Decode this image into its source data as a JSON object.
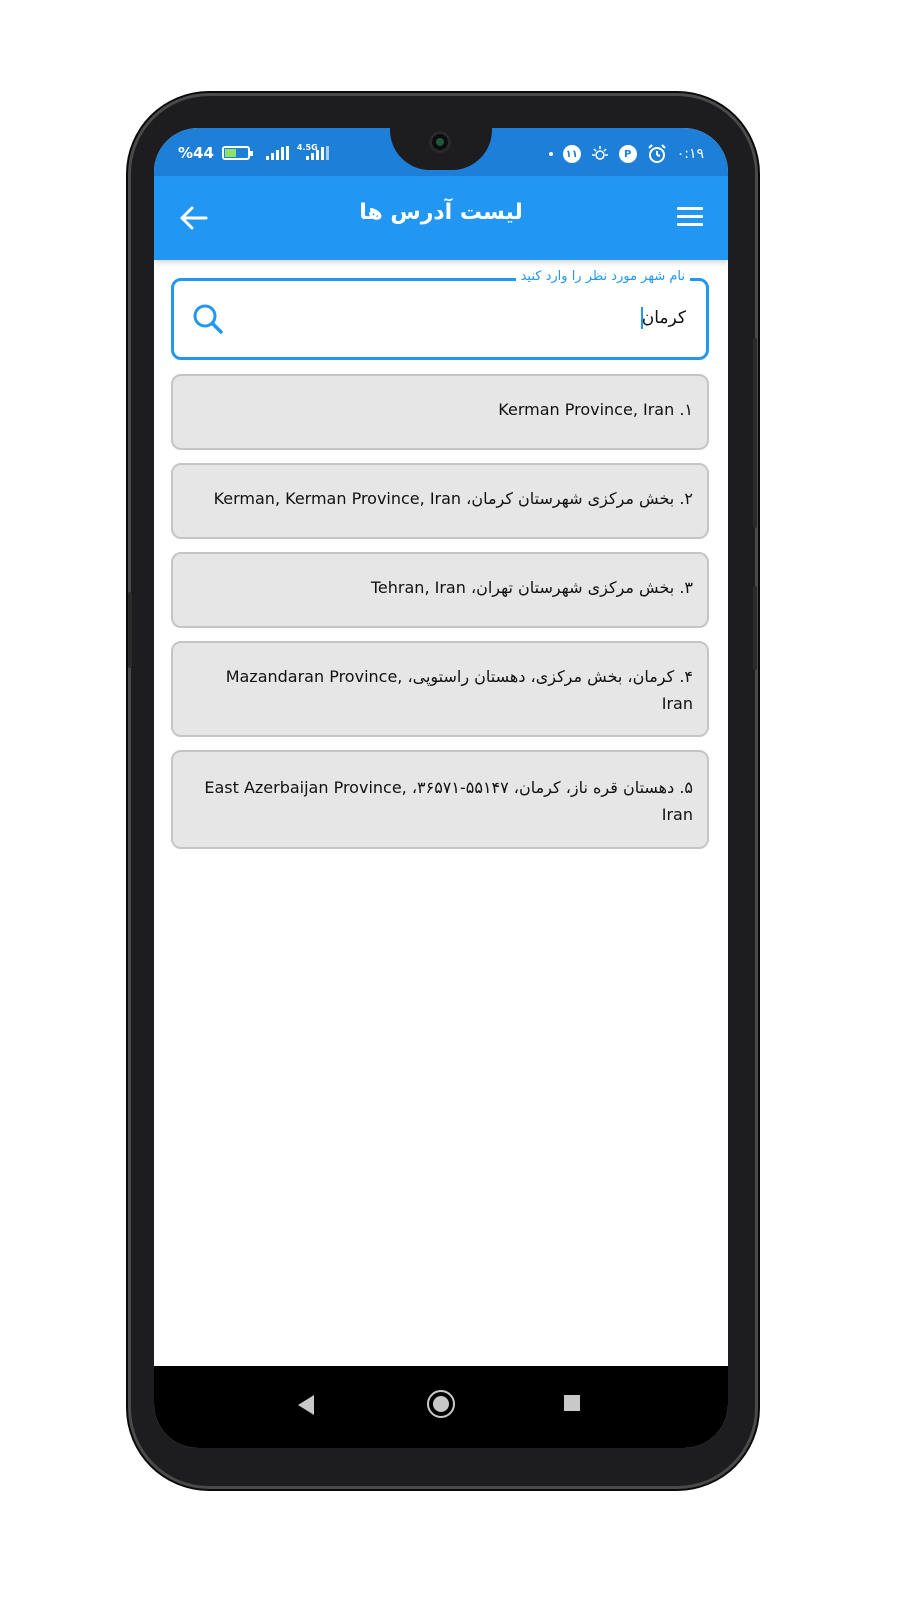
{
  "status_bar": {
    "battery_percent": "%44",
    "network_type": "4.5G",
    "notification_count": "۱۱",
    "time": "۰:۱۹"
  },
  "app_bar": {
    "title": "لیست آدرس ها",
    "back_icon": "arrow-left-icon",
    "menu_icon": "hamburger-menu-icon"
  },
  "search": {
    "label": "نام شهر مورد نظر را وارد کنید",
    "value": "کرمان",
    "icon": "search-icon"
  },
  "results": [
    "۱. Kerman Province, Iran",
    "۲. بخش مرکزی شهرستان کرمان، Kerman, Kerman Province, Iran",
    "۳. بخش مرکزی شهرستان تهران، Tehran, Iran",
    "۴. کرمان، بخش مرکزی، دهستان راستوپی، Mazandaran Province, Iran",
    "۵. دهستان قره ناز، کرمان، ۵۵۱۴۷-۳۶۵۷۱، East Azerbaijan Province, Iran"
  ],
  "colors": {
    "primary": "#2196f3",
    "status_bar": "#1e7fd8",
    "item_background": "#e6e6e6"
  }
}
